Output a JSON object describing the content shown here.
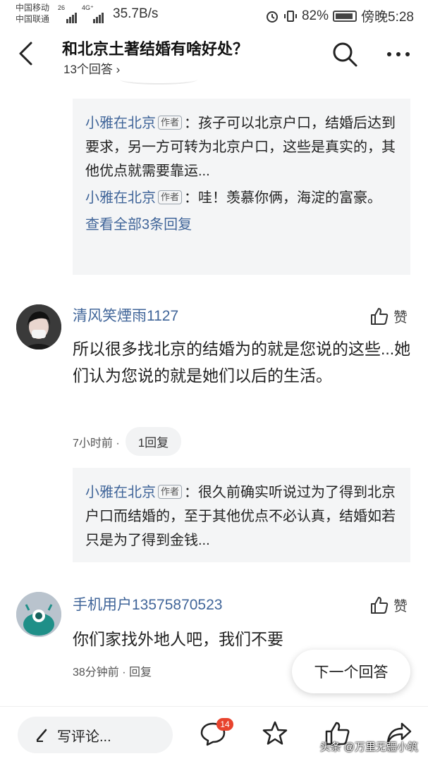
{
  "status_bar": {
    "carrier1": "中国移动",
    "carrier2": "中国联通",
    "net1": "26",
    "net2": "4G⁺",
    "speed": "35.7B/s",
    "battery": "82%",
    "time": "傍晚5:28"
  },
  "header": {
    "title": "和北京土著结婚有啥好处？",
    "answer_count": "13个回答 ›"
  },
  "reply_box_1": {
    "replies": [
      {
        "name": "小雅在北京",
        "tag": "作者",
        "text": "：孩子可以北京户口，结婚后达到要求，另一方可转为北京户口，这些是真实的，其他优点就需要靠运..."
      },
      {
        "name": "小雅在北京",
        "tag": "作者",
        "text": "：哇！羡慕你俩，海淀的富豪。"
      }
    ],
    "view_all": "查看全部3条回复"
  },
  "comment_1": {
    "username": "清风笑煙雨1127",
    "like_label": "赞",
    "text": "所以很多找北京的结婚为的就是您说的这些...她们认为您说的就是她们以后的生活。",
    "time": "7小时前 ·",
    "reply_button": "1回复"
  },
  "reply_box_2": {
    "replies": [
      {
        "name": "小雅在北京",
        "tag": "作者",
        "text": "：很久前确实听说过为了得到北京户口而结婚的，至于其他优点不必认真，结婚如若只是为了得到金钱..."
      }
    ]
  },
  "comment_2": {
    "username": "手机用户13575870523",
    "like_label": "赞",
    "text": "你们家找外地人吧，我们不要",
    "time": "38分钟前 · 回复"
  },
  "next_answer": "下一个回答",
  "bottom_bar": {
    "write_comment": "写评论...",
    "comment_badge": "14",
    "watermark": "头条 @万里无疆小筑"
  },
  "icons": {
    "back": "back-arrow-icon",
    "search": "search-icon",
    "more": "more-dots-icon",
    "like": "thumbs-up-icon",
    "pen": "pen-icon",
    "comment": "comment-bubble-icon",
    "star": "star-icon",
    "share": "share-icon"
  },
  "colors": {
    "link_blue": "#406599",
    "reply_bg": "#f4f5f6",
    "badge_red": "#e8432d"
  }
}
